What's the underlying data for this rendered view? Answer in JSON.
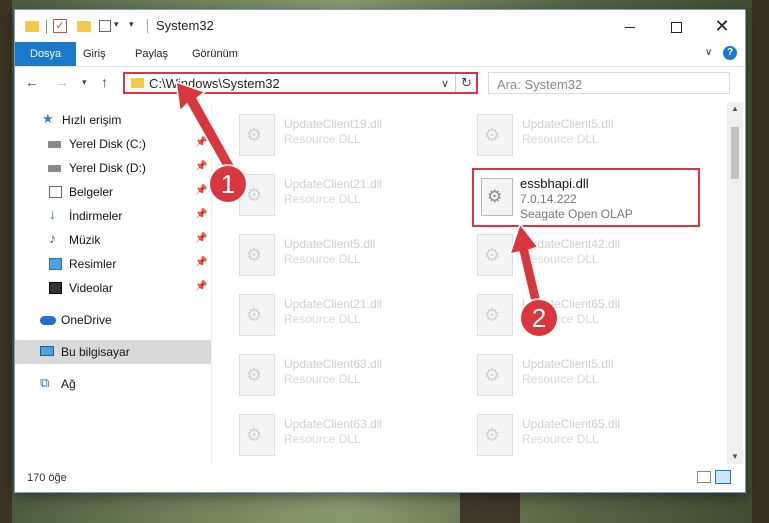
{
  "window": {
    "title": "System32"
  },
  "ribbon": {
    "tabs": [
      "Dosya",
      "Giriş",
      "Paylaş",
      "Görünüm"
    ],
    "help": "?"
  },
  "address": {
    "path": "C:\\Windows\\System32",
    "search_placeholder": "Ara: System32"
  },
  "sidebar": {
    "items": [
      {
        "label": "Hızlı erişim",
        "icon": "star-icon"
      },
      {
        "label": "Yerel Disk (C:)",
        "icon": "drive-icon",
        "pinned": true
      },
      {
        "label": "Yerel Disk (D:)",
        "icon": "drive-icon",
        "pinned": true
      },
      {
        "label": "Belgeler",
        "icon": "documents-icon",
        "pinned": true
      },
      {
        "label": "İndirmeler",
        "icon": "download-icon",
        "pinned": true
      },
      {
        "label": "Müzik",
        "icon": "music-icon",
        "pinned": true
      },
      {
        "label": "Resimler",
        "icon": "pictures-icon",
        "pinned": true
      },
      {
        "label": "Videolar",
        "icon": "video-icon",
        "pinned": true
      },
      {
        "label": "OneDrive",
        "icon": "cloud-icon"
      },
      {
        "label": "Bu bilgisayar",
        "icon": "computer-icon",
        "selected": true
      },
      {
        "label": "Ağ",
        "icon": "network-icon"
      }
    ]
  },
  "files": {
    "left": [
      {
        "name": "UpdateClient19.dll",
        "type": "Resource DLL"
      },
      {
        "name": "UpdateClient21.dll",
        "type": "Resource DLL"
      },
      {
        "name": "UpdateClient5.dll",
        "type": "Resource DLL"
      },
      {
        "name": "UpdateClient21.dll",
        "type": "Resource DLL"
      },
      {
        "name": "UpdateClient63.dll",
        "type": "Resource DLL"
      },
      {
        "name": "UpdateClient63.dll",
        "type": "Resource DLL"
      }
    ],
    "right": [
      {
        "name": "UpdateClient5.dll",
        "type": "Resource DLL"
      },
      {
        "name": "UpdateClient42.dll",
        "type": "Resource DLL"
      },
      {
        "name": "UpdateClient65.dll",
        "type": "Resource DLL"
      },
      {
        "name": "UpdateClient5.dll",
        "type": "Resource DLL"
      },
      {
        "name": "UpdateClient65.dll",
        "type": "Resource DLL"
      }
    ],
    "highlighted": {
      "name": "essbhapi.dll",
      "version": "7.0.14.222",
      "description": "Seagate Open OLAP"
    }
  },
  "status": {
    "count": "170 öğe"
  },
  "annotations": {
    "step1": "1",
    "step2": "2",
    "color": "#d9363e"
  }
}
